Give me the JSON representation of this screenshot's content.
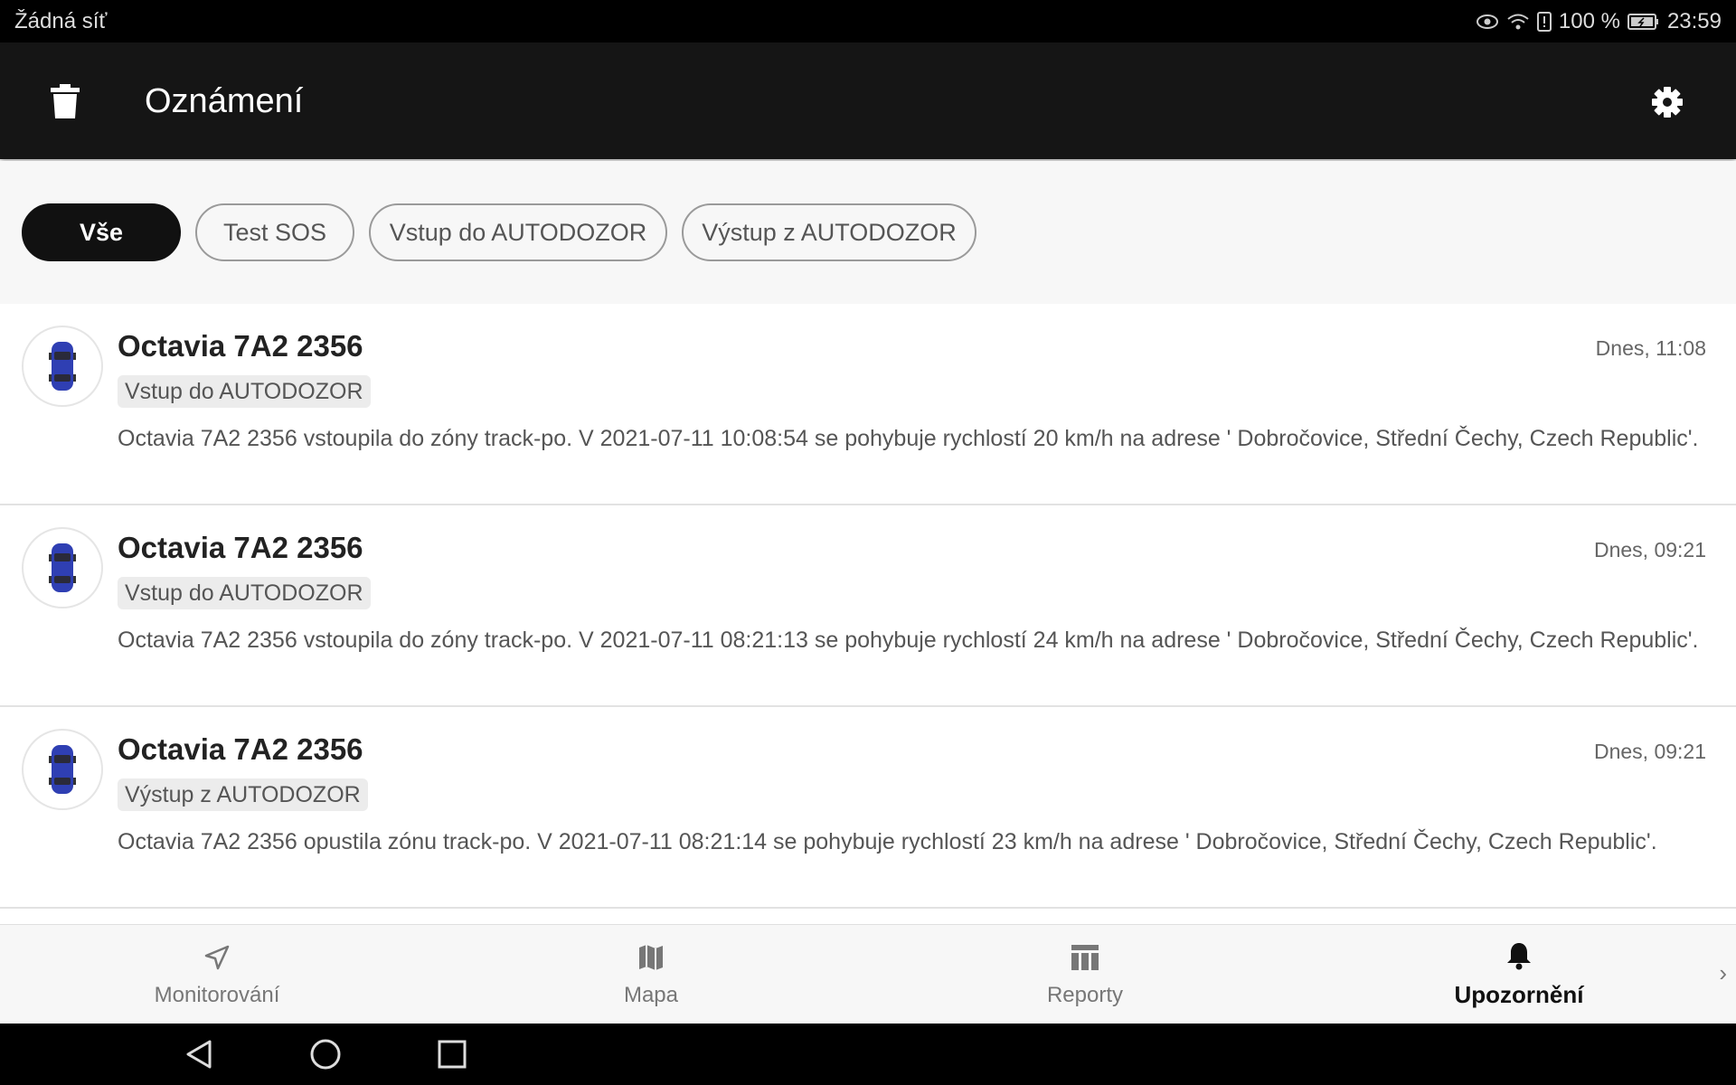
{
  "status_bar": {
    "carrier": "Žádná síť",
    "battery": "100 %",
    "time": "23:59"
  },
  "app_bar": {
    "title": "Oznámení",
    "delete_icon": "trash-icon",
    "settings_icon": "gear-icon"
  },
  "filters": [
    {
      "label": "Vše",
      "active": true
    },
    {
      "label": "Test SOS",
      "active": false
    },
    {
      "label": "Vstup do AUTODOZOR",
      "active": false
    },
    {
      "label": "Výstup z AUTODOZOR",
      "active": false
    }
  ],
  "notifications": [
    {
      "title": "Octavia 7A2 2356",
      "time": "Dnes, 11:08",
      "tag": "Vstup do AUTODOZOR",
      "body": "Octavia 7A2 2356 vstoupila do zóny track-po. V 2021-07-11 10:08:54  se pohybuje rychlostí 20 km/h na adrese ' Dobročovice, Střední Čechy, Czech Republic'."
    },
    {
      "title": "Octavia 7A2 2356",
      "time": "Dnes, 09:21",
      "tag": "Vstup do AUTODOZOR",
      "body": "Octavia 7A2 2356 vstoupila do zóny track-po. V 2021-07-11 08:21:13  se pohybuje rychlostí 24 km/h na adrese ' Dobročovice, Střední Čechy, Czech Republic'."
    },
    {
      "title": "Octavia 7A2 2356",
      "time": "Dnes, 09:21",
      "tag": "Výstup z AUTODOZOR",
      "body": "Octavia 7A2 2356 opustila zónu track-po. V 2021-07-11 08:21:14 se pohybuje rychlostí 23 km/h na adrese ' Dobročovice, Střední Čechy, Czech Republic'."
    }
  ],
  "bottom_nav": [
    {
      "label": "Monitorování",
      "icon": "navigation-arrow-icon",
      "active": false
    },
    {
      "label": "Mapa",
      "icon": "map-icon",
      "active": false
    },
    {
      "label": "Reporty",
      "icon": "table-icon",
      "active": false
    },
    {
      "label": "Upozornění",
      "icon": "bell-icon",
      "active": true
    }
  ],
  "bottom_nav_more": "›",
  "colors": {
    "app_bar_bg": "#151515",
    "chip_active_bg": "#111111",
    "car_blue": "#2f3fb3"
  }
}
